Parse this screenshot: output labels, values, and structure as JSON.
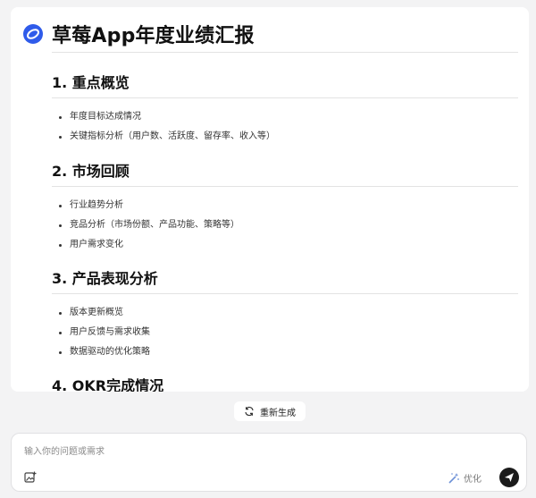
{
  "document": {
    "title": "草莓App年度业绩汇报",
    "sections": [
      {
        "heading": "1. 重点概览",
        "items": [
          "年度目标达成情况",
          "关键指标分析（用户数、活跃度、留存率、收入等）"
        ]
      },
      {
        "heading": "2. 市场回顾",
        "items": [
          "行业趋势分析",
          "竞品分析（市场份额、产品功能、策略等）",
          "用户需求变化"
        ]
      },
      {
        "heading": "3. 产品表现分析",
        "items": [
          "版本更新概览",
          "用户反馈与需求收集",
          "数据驱动的优化策略"
        ]
      },
      {
        "heading": "4. OKR完成情况",
        "items": []
      }
    ]
  },
  "regenerate": {
    "label": "重新生成",
    "icon": "refresh-icon"
  },
  "composer": {
    "placeholder": "输入你的问题或需求",
    "value": "",
    "optimize_label": "优化",
    "attach_icon": "image-upload-icon",
    "send_icon": "send-icon"
  },
  "colors": {
    "logo": "#2f5bea",
    "send_button": "#1b1b1b",
    "page_bg": "#f3f3f4"
  }
}
